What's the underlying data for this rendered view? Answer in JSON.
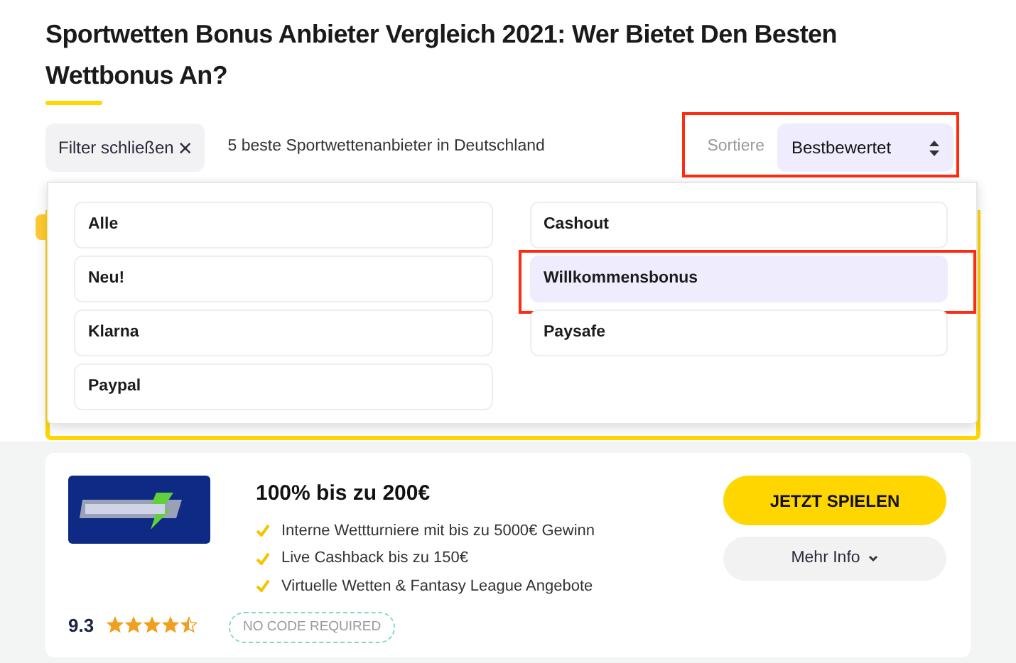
{
  "title": "Sportwetten Bonus Anbieter Vergleich 2021: Wer Bietet Den Besten Wettbonus An?",
  "filter_button": {
    "label": "Filter schließen",
    "icon": "×"
  },
  "result_count": "5 beste Sportwettenanbieter in Deutschland",
  "sort": {
    "label": "Sortiere",
    "value": "Bestbewertet",
    "highlighted": true
  },
  "filters": [
    {
      "label": "Alle",
      "selected": false,
      "highlighted": false
    },
    {
      "label": "Cashout",
      "selected": false,
      "highlighted": false
    },
    {
      "label": "Neu!",
      "selected": false,
      "highlighted": false
    },
    {
      "label": "Willkommensbonus",
      "selected": true,
      "highlighted": true
    },
    {
      "label": "Klarna",
      "selected": false,
      "highlighted": false
    },
    {
      "label": "Paysafe",
      "selected": false,
      "highlighted": false
    },
    {
      "label": "Paypal",
      "selected": false,
      "highlighted": false
    }
  ],
  "offer": {
    "headline": "100% bis zu 200€",
    "features": [
      "Interne Wettturniere mit bis zu 5000€ Gewinn",
      "Live Cashback bis zu 150€",
      "Virtuelle Wetten & Fantasy League Angebote"
    ],
    "rating": "9.3",
    "stars": 4.5,
    "badge": "NO CODE REQUIRED",
    "primary_button": "JETZT SPIELEN",
    "secondary_button": "Mehr Info"
  }
}
